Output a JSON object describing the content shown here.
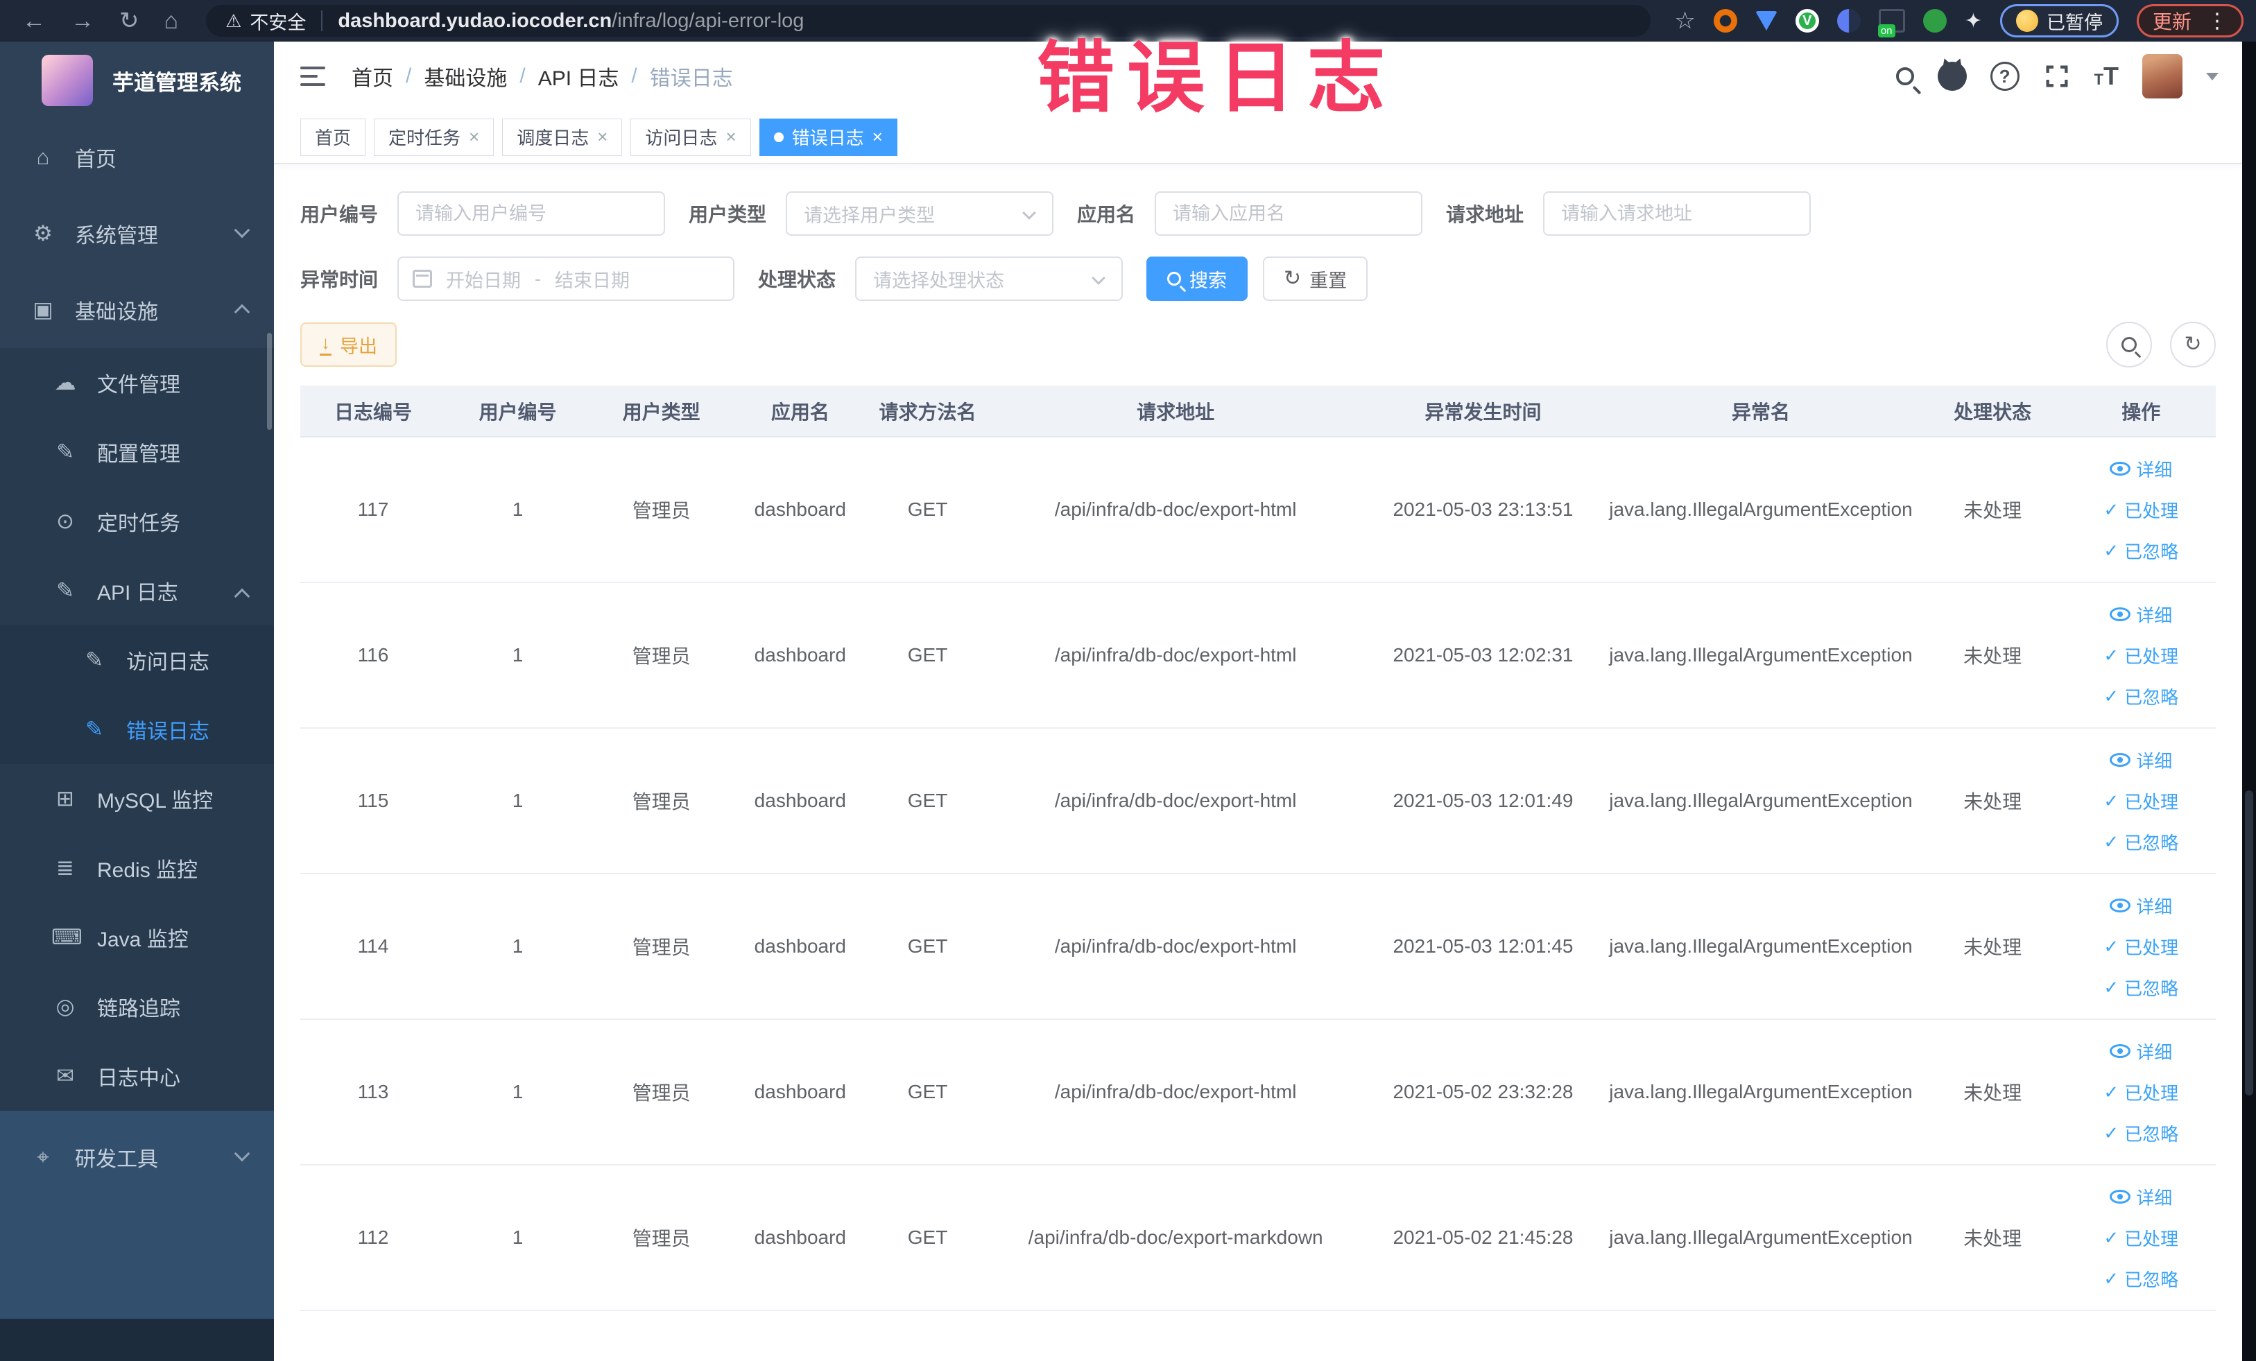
{
  "browser": {
    "security_label": "不安全",
    "url_domain": "dashboard.yudao.iocoder.cn",
    "url_path": "/infra/log/api-error-log",
    "paused_label": "已暂停",
    "update_label": "更新"
  },
  "annotation_text": "错误日志",
  "sidebar": {
    "logo_title": "芋道管理系统",
    "items": [
      {
        "label": "首页",
        "icon": "home-icon",
        "depth": 0
      },
      {
        "label": "系统管理",
        "icon": "gear-icon",
        "depth": 0,
        "arrow": "down"
      },
      {
        "label": "基础设施",
        "icon": "infrastructure-icon",
        "depth": 0,
        "arrow": "up"
      },
      {
        "label": "文件管理",
        "icon": "file-manage-icon",
        "depth": 1
      },
      {
        "label": "配置管理",
        "icon": "config-manage-icon",
        "depth": 1
      },
      {
        "label": "定时任务",
        "icon": "scheduled-job-icon",
        "depth": 1
      },
      {
        "label": "API 日志",
        "icon": "api-log-icon",
        "depth": 1,
        "arrow": "up"
      },
      {
        "label": "访问日志",
        "icon": "access-log-icon",
        "depth": 2
      },
      {
        "label": "错误日志",
        "icon": "error-log-icon",
        "depth": 2,
        "active": true
      },
      {
        "label": "MySQL 监控",
        "icon": "mysql-monitor-icon",
        "depth": 1
      },
      {
        "label": "Redis 监控",
        "icon": "redis-monitor-icon",
        "depth": 1
      },
      {
        "label": "Java 监控",
        "icon": "java-monitor-icon",
        "depth": 1
      },
      {
        "label": "链路追踪",
        "icon": "trace-icon",
        "depth": 1
      },
      {
        "label": "日志中心",
        "icon": "log-center-icon",
        "depth": 1
      },
      {
        "label": "研发工具",
        "icon": "dev-tools-icon",
        "depth": 0,
        "arrow": "down",
        "section": "light"
      }
    ]
  },
  "header": {
    "breadcrumb": [
      "首页",
      "基础设施",
      "API 日志",
      "错误日志"
    ]
  },
  "tabs": [
    {
      "label": "首页",
      "closable": false,
      "active": false
    },
    {
      "label": "定时任务",
      "closable": true,
      "active": false
    },
    {
      "label": "调度日志",
      "closable": true,
      "active": false
    },
    {
      "label": "访问日志",
      "closable": true,
      "active": false
    },
    {
      "label": "错误日志",
      "closable": true,
      "active": true
    }
  ],
  "filters": {
    "user_id_label": "用户编号",
    "user_id_placeholder": "请输入用户编号",
    "user_type_label": "用户类型",
    "user_type_placeholder": "请选择用户类型",
    "app_name_label": "应用名",
    "app_name_placeholder": "请输入应用名",
    "request_url_label": "请求地址",
    "request_url_placeholder": "请输入请求地址",
    "exception_time_label": "异常时间",
    "start_date_placeholder": "开始日期",
    "range_separator": "-",
    "end_date_placeholder": "结束日期",
    "process_status_label": "处理状态",
    "process_status_placeholder": "请选择处理状态",
    "search_label": "搜索",
    "reset_label": "重置"
  },
  "toolbar": {
    "export_label": "导出"
  },
  "table": {
    "columns": [
      "日志编号",
      "用户编号",
      "用户类型",
      "应用名",
      "请求方法名",
      "请求地址",
      "异常发生时间",
      "异常名",
      "处理状态",
      "操作"
    ],
    "actions": [
      "详细",
      "已处理",
      "已忽略"
    ],
    "rows": [
      {
        "id": "117",
        "user_id": "1",
        "user_type": "管理员",
        "app": "dashboard",
        "method": "GET",
        "url": "/api/infra/db-doc/export-html",
        "time": "2021-05-03 23:13:51",
        "exception": "java.lang.IllegalArgumentException",
        "status": "未处理"
      },
      {
        "id": "116",
        "user_id": "1",
        "user_type": "管理员",
        "app": "dashboard",
        "method": "GET",
        "url": "/api/infra/db-doc/export-html",
        "time": "2021-05-03 12:02:31",
        "exception": "java.lang.IllegalArgumentException",
        "status": "未处理"
      },
      {
        "id": "115",
        "user_id": "1",
        "user_type": "管理员",
        "app": "dashboard",
        "method": "GET",
        "url": "/api/infra/db-doc/export-html",
        "time": "2021-05-03 12:01:49",
        "exception": "java.lang.IllegalArgumentException",
        "status": "未处理"
      },
      {
        "id": "114",
        "user_id": "1",
        "user_type": "管理员",
        "app": "dashboard",
        "method": "GET",
        "url": "/api/infra/db-doc/export-html",
        "time": "2021-05-03 12:01:45",
        "exception": "java.lang.IllegalArgumentException",
        "status": "未处理"
      },
      {
        "id": "113",
        "user_id": "1",
        "user_type": "管理员",
        "app": "dashboard",
        "method": "GET",
        "url": "/api/infra/db-doc/export-html",
        "time": "2021-05-02 23:32:28",
        "exception": "java.lang.IllegalArgumentException",
        "status": "未处理"
      },
      {
        "id": "112",
        "user_id": "1",
        "user_type": "管理员",
        "app": "dashboard",
        "method": "GET",
        "url": "/api/infra/db-doc/export-markdown",
        "time": "2021-05-02 21:45:28",
        "exception": "java.lang.IllegalArgumentException",
        "status": "未处理"
      }
    ]
  },
  "colors": {
    "primary": "#409eff",
    "warning": "#e6a23c",
    "sidebar": "#2e4156",
    "annotation": "#f43b63",
    "action_link": "#3ba3f8"
  }
}
